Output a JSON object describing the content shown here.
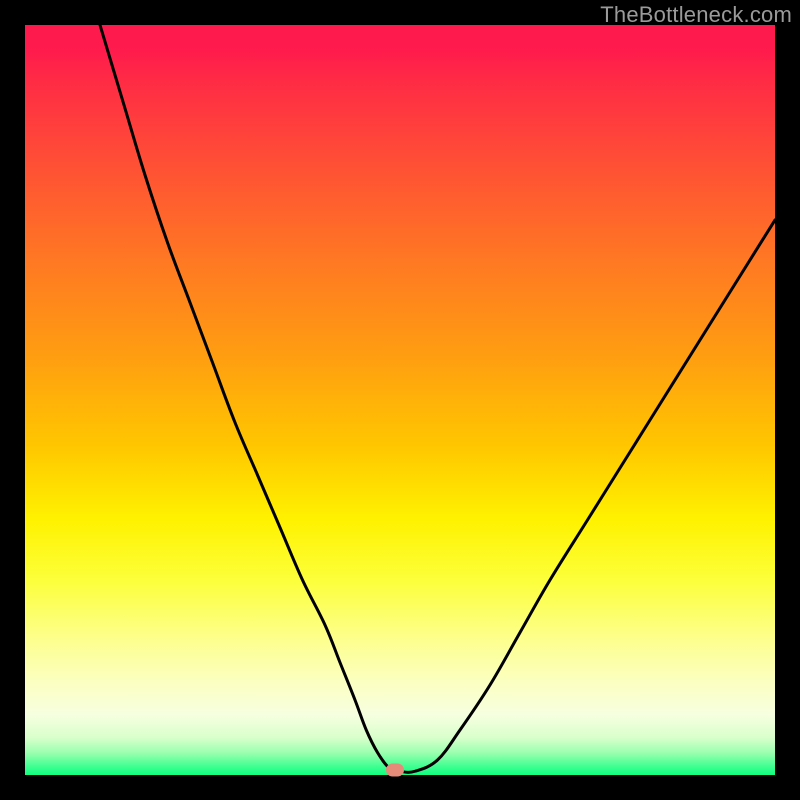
{
  "watermark": "TheBottleneck.com",
  "marker": {
    "x_frac": 0.493,
    "y_frac": 0.993
  },
  "chart_data": {
    "type": "line",
    "title": "",
    "xlabel": "",
    "ylabel": "",
    "xlim": [
      0,
      100
    ],
    "ylim": [
      0,
      100
    ],
    "series": [
      {
        "name": "bottleneck-curve",
        "x": [
          10,
          13,
          16,
          19,
          22,
          25,
          28,
          31,
          34,
          37,
          40,
          42,
          44,
          45.5,
          47,
          48.5,
          50,
          52,
          55,
          58,
          62,
          66,
          70,
          75,
          80,
          85,
          90,
          95,
          100
        ],
        "y": [
          100,
          90,
          80,
          71,
          63,
          55,
          47,
          40,
          33,
          26,
          20,
          15,
          10,
          6,
          3,
          1,
          0.5,
          0.5,
          2,
          6,
          12,
          19,
          26,
          34,
          42,
          50,
          58,
          66,
          74
        ]
      }
    ],
    "annotations": [
      {
        "name": "optimal-point",
        "x": 49.3,
        "y": 0.7
      }
    ],
    "background_gradient": {
      "top": "#ff1a4d",
      "mid": "#fff200",
      "bottom": "#10ff7f"
    }
  }
}
